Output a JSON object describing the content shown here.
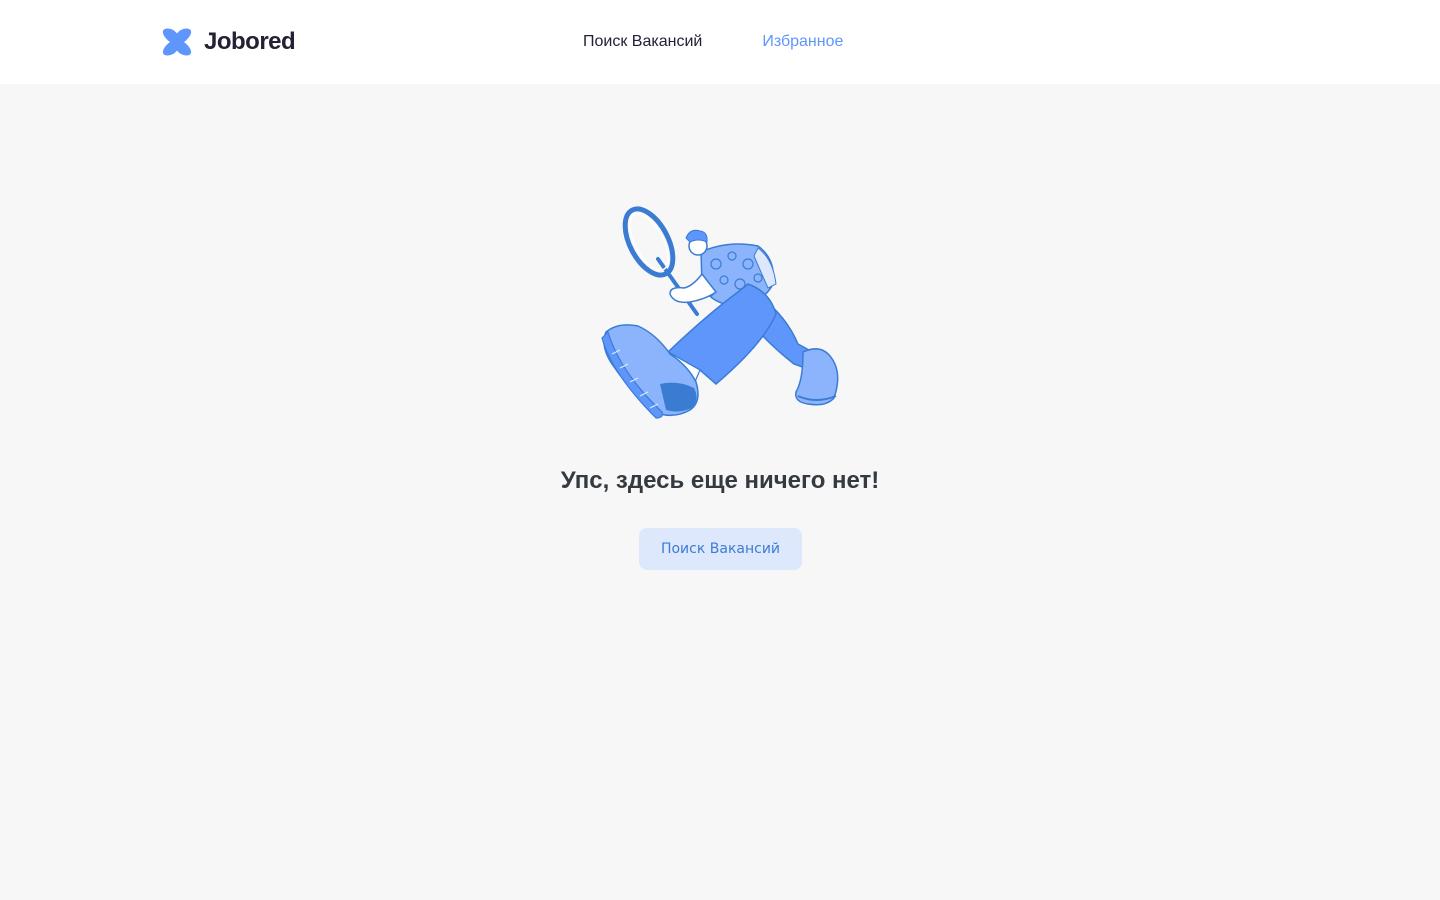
{
  "header": {
    "logo_icon": "jobored-logo-icon",
    "logo_text": "Jobored",
    "nav": [
      {
        "label": "Поиск Вакансий",
        "active": false
      },
      {
        "label": "Избранное",
        "active": true
      }
    ]
  },
  "empty_state": {
    "illustration": "person-with-magnifying-glass-illustration",
    "title": "Упс, здесь еще ничего нет!",
    "button_label": "Поиск Вакансий"
  },
  "colors": {
    "accent": "#5e96fc",
    "button_bg": "#dee8fd",
    "button_text": "#3b7cd3",
    "title_text": "#343a40",
    "page_bg": "#f7f7f8"
  }
}
